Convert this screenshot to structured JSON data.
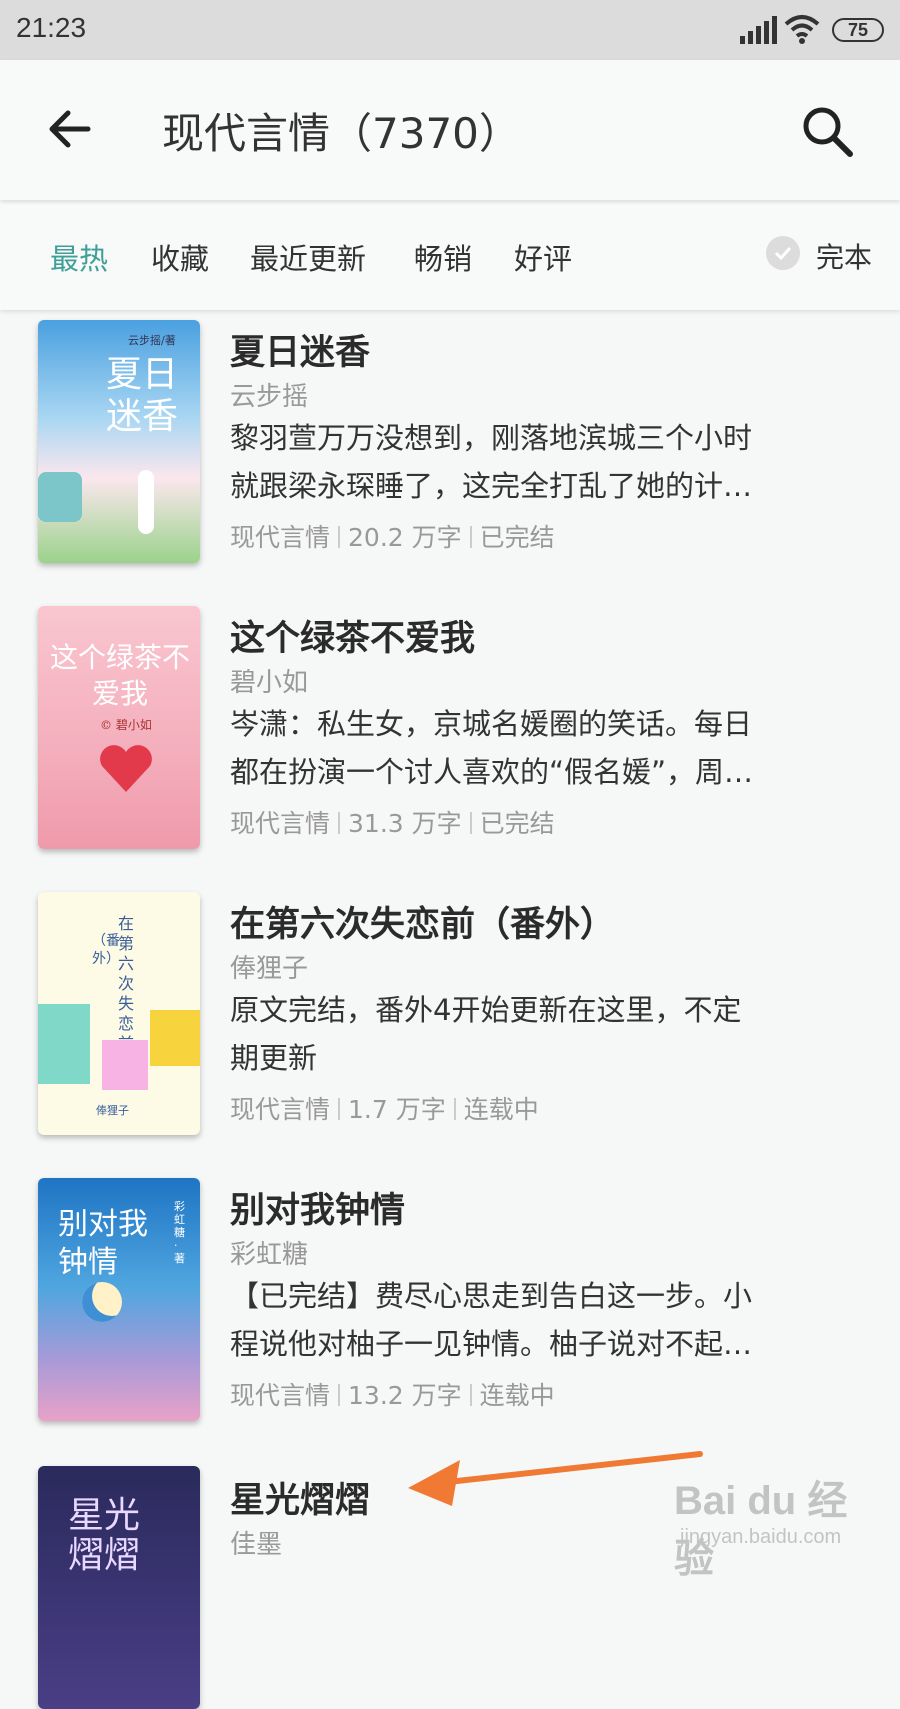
{
  "status": {
    "time": "21:23",
    "battery": "75"
  },
  "header": {
    "title": "现代言情（7370）",
    "back_icon": "back-arrow-icon",
    "search_icon": "search-icon"
  },
  "filters": {
    "tabs": [
      "最热",
      "收藏",
      "最近更新",
      "畅销",
      "好评"
    ],
    "active": "最热",
    "complete_label": "完本"
  },
  "colors": {
    "accent": "#3f9f97",
    "arrow": "#f07a34"
  },
  "books": [
    {
      "title": "夏日迷香",
      "author": "云步摇",
      "desc1": "黎羽萱万万没想到，刚落地滨城三个小时",
      "desc2": "就跟梁永琛睡了，这完全打乱了她的计…",
      "genre": "现代言情",
      "words": "20.2 万字",
      "state": "已完结",
      "cover_title": "夏日迷香",
      "cover_author": "云步摇/著"
    },
    {
      "title": "这个绿茶不爱我",
      "author": "碧小如",
      "desc1": "岑潇：私生女，京城名媛圈的笑话。每日",
      "desc2": "都在扮演一个讨人喜欢的“假名媛”，周…",
      "genre": "现代言情",
      "words": "31.3 万字",
      "state": "已完结",
      "cover_title": "这个绿茶不爱我",
      "cover_author": "© 碧小如"
    },
    {
      "title": "在第六次失恋前（番外）",
      "author": "俸狸子",
      "desc1": "原文完结，番外4开始更新在这里，不定",
      "desc2": "期更新",
      "genre": "现代言情",
      "words": "1.7 万字",
      "state": "连载中",
      "cover_title": "在第六次失恋前",
      "cover_sub": "（番外）",
      "cover_author": "俸狸子"
    },
    {
      "title": "别对我钟情",
      "author": "彩虹糖",
      "desc1": "【已完结】费尽心思走到告白这一步。小",
      "desc2": "程说他对柚子一见钟情。柚子说对不起…",
      "genre": "现代言情",
      "words": "13.2 万字",
      "state": "连载中",
      "cover_title": "别对我钟情",
      "cover_author": "彩虹糖·著"
    },
    {
      "title": "星光熠熠",
      "author": "佳墨",
      "cover_title": "星光熠熠"
    }
  ],
  "watermark": {
    "brand": "Bai du 经验",
    "url": "jingyan.baidu.com"
  }
}
